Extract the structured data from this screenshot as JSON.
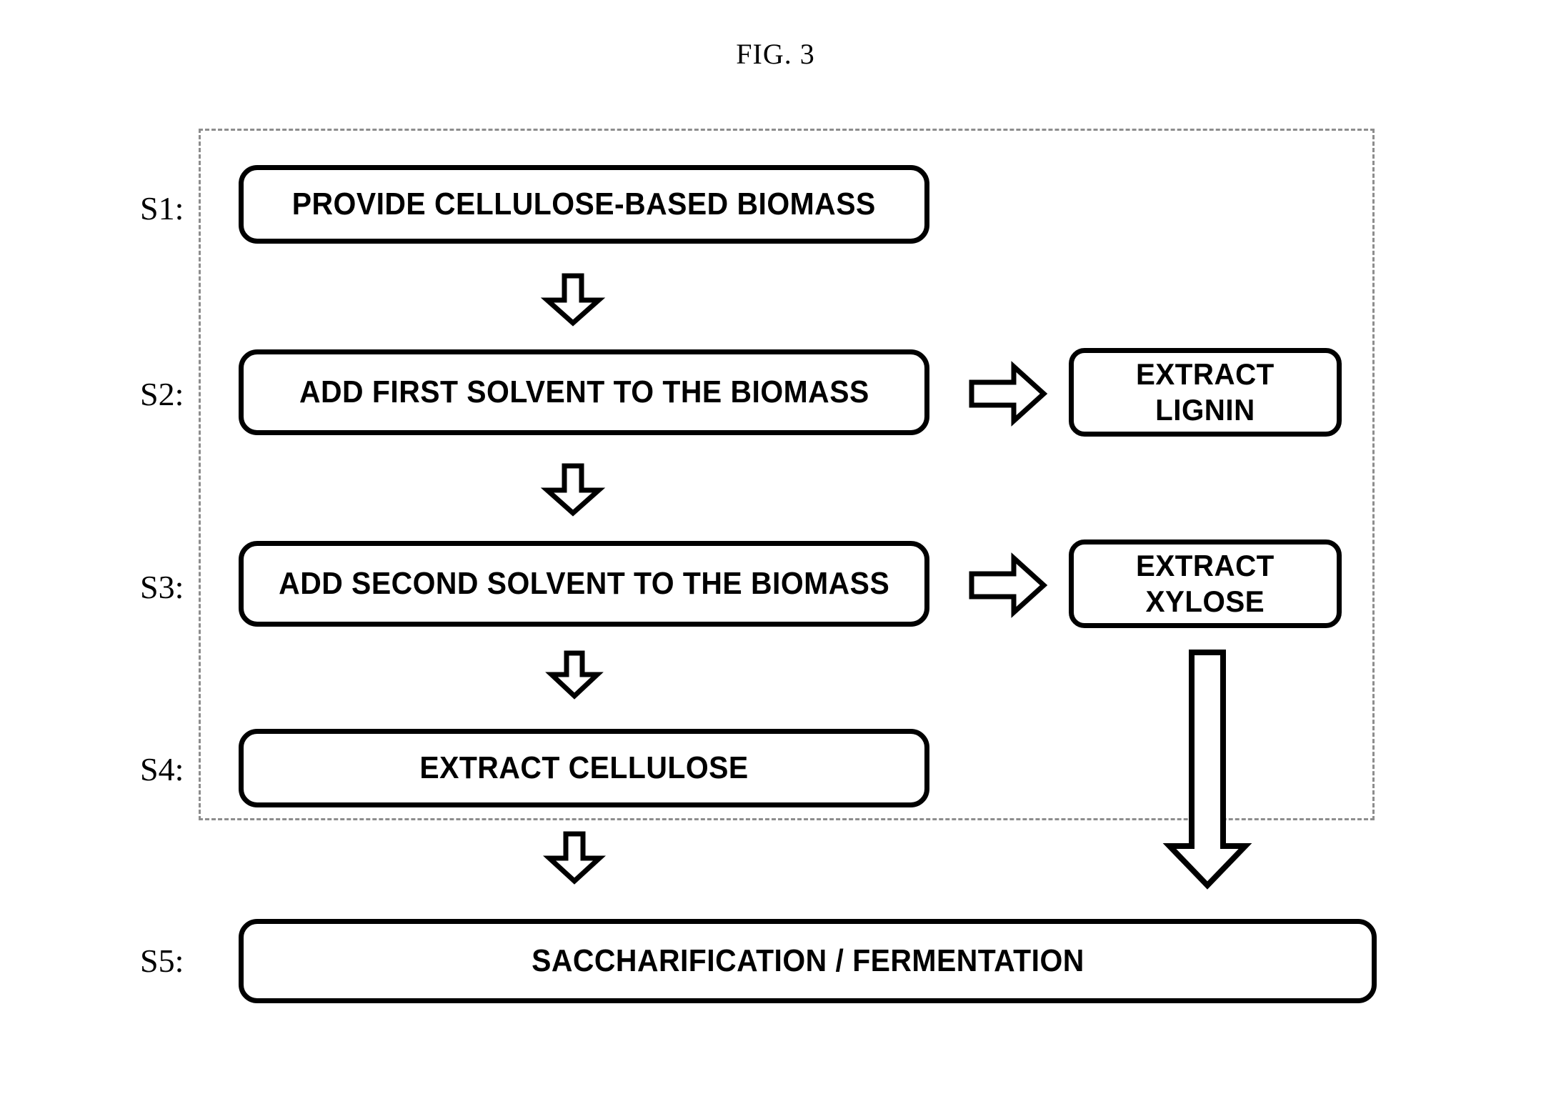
{
  "figure": {
    "title": "FIG. 3"
  },
  "diagram": {
    "type": "flowchart",
    "container_label": "dashed-process-region",
    "steps": [
      {
        "id": "S1",
        "label": "S1:",
        "text": "PROVIDE CELLULOSE-BASED BIOMASS"
      },
      {
        "id": "S2",
        "label": "S2:",
        "text": "ADD FIRST SOLVENT TO THE BIOMASS"
      },
      {
        "id": "S3",
        "label": "S3:",
        "text": "ADD SECOND SOLVENT TO THE BIOMASS"
      },
      {
        "id": "S4",
        "label": "S4:",
        "text": "EXTRACT CELLULOSE"
      },
      {
        "id": "S5",
        "label": "S5:",
        "text": "SACCHARIFICATION / FERMENTATION"
      }
    ],
    "side_outputs": [
      {
        "id": "lignin",
        "text": "EXTRACT\nLIGNIN",
        "from_step": "S2"
      },
      {
        "id": "xylose",
        "text": "EXTRACT\nXYLOSE",
        "from_step": "S3"
      }
    ],
    "connectors": [
      {
        "id": "s1-to-s2",
        "direction": "down"
      },
      {
        "id": "s2-to-s3",
        "direction": "down"
      },
      {
        "id": "s3-to-s4",
        "direction": "down"
      },
      {
        "id": "s4-to-s5",
        "direction": "down"
      },
      {
        "id": "s2-to-lignin",
        "direction": "right"
      },
      {
        "id": "s3-to-xylose",
        "direction": "right"
      },
      {
        "id": "xylose-to-s5",
        "direction": "down-long"
      }
    ],
    "colors": {
      "stroke": "#000000",
      "fill": "#ffffff",
      "dashed_border": "#8d8d8d",
      "background": "#ffffff"
    }
  }
}
